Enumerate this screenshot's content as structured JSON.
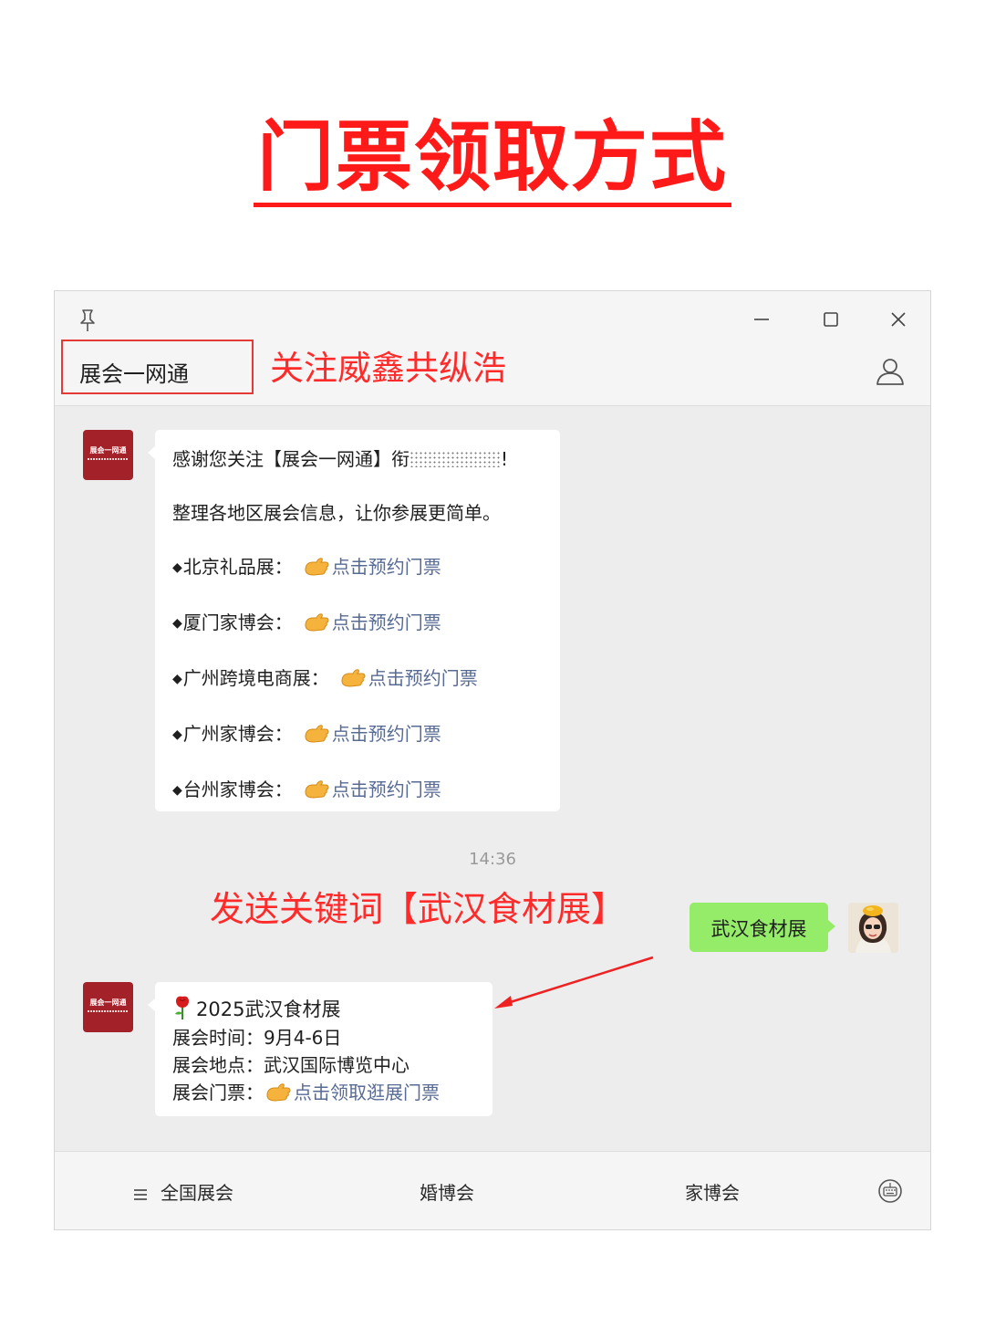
{
  "headline": "门票领取方式",
  "window": {
    "chat_name": "展会一网通",
    "overlay_follow": "关注威鑫共纵浩"
  },
  "chat": {
    "bot_avatar_text": "展会一网通",
    "welcome": {
      "line1_prefix": "感谢您关注【展会一网通】",
      "line1_mid": "衔",
      "line1_suffix": "!",
      "line2": "整理各地区展会信息，让你参展更简单。",
      "bullet": "◆",
      "link_text": "点击预约门票",
      "items": [
        "北京礼品展：",
        "厦门家博会：",
        "广州跨境电商展：",
        "广州家博会：",
        "台州家博会："
      ]
    },
    "timestamp": "14:36",
    "overlay_send": "发送关键词【武汉食材展】",
    "user_message": "武汉食材展",
    "reply": {
      "title": "2025武汉食材展",
      "time_label": "展会时间：",
      "time_value": "9月4-6日",
      "place_label": "展会地点：",
      "place_value": "武汉国际博览中心",
      "ticket_label": "展会门票：",
      "ticket_link": "点击领取逛展门票"
    }
  },
  "menu": {
    "items": [
      "全国展会",
      "婚博会",
      "家博会"
    ]
  },
  "colors": {
    "accent_red": "#ff2a2a",
    "link": "#576b95",
    "user_bubble": "#95ec69",
    "bot_avatar": "#a3222a"
  },
  "icons": [
    "pin-icon",
    "minimize-icon",
    "maximize-icon",
    "close-icon",
    "profile-icon",
    "pointing-hand-icon",
    "rose-icon",
    "menu-list-icon",
    "emoji-keyboard-icon"
  ]
}
